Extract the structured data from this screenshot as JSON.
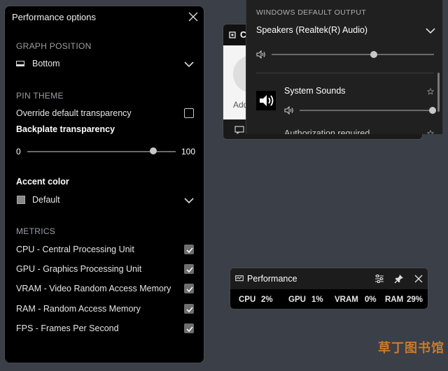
{
  "options_panel": {
    "title": "Performance options",
    "graph_position": {
      "section": "GRAPH POSITION",
      "value": "Bottom"
    },
    "pin_theme": {
      "section": "PIN THEME",
      "override_label": "Override default transparency",
      "override_checked": false,
      "backplate_label": "Backplate transparency",
      "slider_min": "0",
      "slider_max": "100",
      "slider_value_fraction": 0.85
    },
    "accent": {
      "label": "Accent color",
      "value": "Default",
      "swatch_color": "#888888"
    },
    "metrics": {
      "section": "METRICS",
      "items": [
        {
          "label": "CPU - Central Processing Unit",
          "checked": true
        },
        {
          "label": "GPU - Graphics Processing Unit",
          "checked": true
        },
        {
          "label": "VRAM - Video Random Access Memory",
          "checked": true
        },
        {
          "label": "RAM - Random Access Memory",
          "checked": true
        },
        {
          "label": "FPS - Frames Per Second",
          "checked": true
        }
      ]
    }
  },
  "audio_panel": {
    "header": "WINDOWS DEFAULT OUTPUT",
    "device": "Speakers (Realtek(R) Audio)",
    "master_volume_fraction": 0.63,
    "app_name": "System Sounds",
    "app_volume_fraction": 1.0,
    "next_app": "Authorization required"
  },
  "bg_widget": {
    "label_fragment": "C",
    "add_fragment": "Add"
  },
  "perf_widget": {
    "title": "Performance",
    "metrics": [
      {
        "name": "CPU",
        "value": "2%"
      },
      {
        "name": "GPU",
        "value": "1%"
      },
      {
        "name": "VRAM",
        "value": "0%"
      },
      {
        "name": "RAM",
        "value": "29%"
      }
    ]
  },
  "watermark": "草丁图书馆"
}
